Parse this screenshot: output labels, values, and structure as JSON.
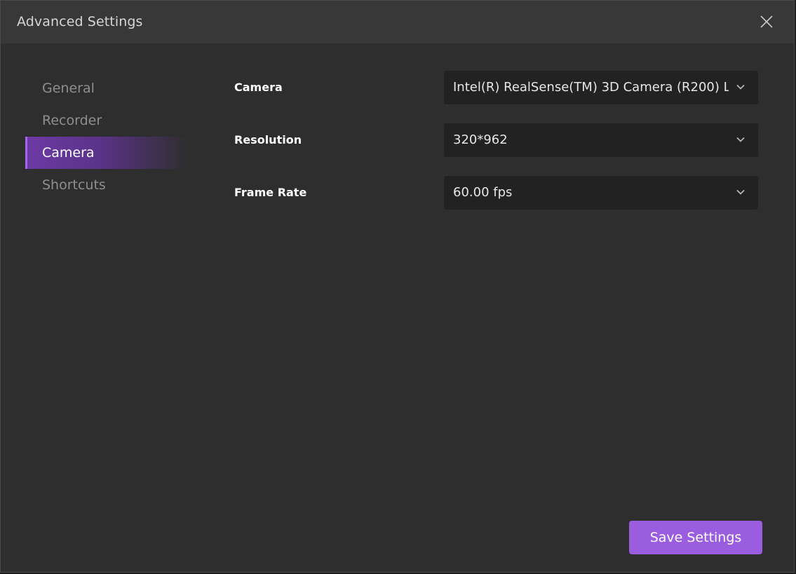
{
  "window": {
    "title": "Advanced Settings"
  },
  "sidebar": {
    "items": [
      {
        "label": "General",
        "active": false
      },
      {
        "label": "Recorder",
        "active": false
      },
      {
        "label": "Camera",
        "active": true
      },
      {
        "label": "Shortcuts",
        "active": false
      }
    ]
  },
  "form": {
    "camera": {
      "label": "Camera",
      "value": "Intel(R) RealSense(TM) 3D Camera (R200) L"
    },
    "resolution": {
      "label": "Resolution",
      "value": "320*962"
    },
    "frame_rate": {
      "label": "Frame Rate",
      "value": "60.00 fps"
    }
  },
  "footer": {
    "save_label": "Save Settings"
  },
  "colors": {
    "accent": "#9b5de0",
    "background": "#2e2e2e",
    "titlebar": "#383838",
    "field_background": "#222222"
  },
  "icons": {
    "close": "close-icon",
    "dropdown": "chevron-down-icon"
  }
}
